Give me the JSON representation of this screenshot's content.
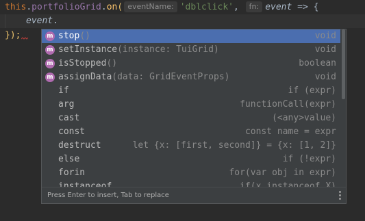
{
  "code": {
    "line1": {
      "this_kw": "this",
      "dot1": ".",
      "prop": "portfolioGrid",
      "dot2": ".",
      "method": "on",
      "open_paren": "(",
      "hint_event_name": "eventName:",
      "string_arg": "'dblclick'",
      "comma": ",",
      "hint_fn": "fn:",
      "param": "event",
      "arrow": "=>",
      "brace": "{"
    },
    "line2": {
      "typed": "event",
      "dot": "."
    },
    "line3": {
      "close": "});"
    }
  },
  "completion": {
    "items": [
      {
        "badge": "m",
        "name": "stop",
        "sig": "()",
        "type": "void",
        "selected": true
      },
      {
        "badge": "m",
        "name": "setInstance",
        "sig": "(instance: TuiGrid)",
        "type": "void"
      },
      {
        "badge": "m",
        "name": "isStopped",
        "sig": "()",
        "type": "boolean"
      },
      {
        "badge": "m",
        "name": "assignData",
        "sig": "(data: GridEventProps)",
        "type": "void"
      },
      {
        "name": "if",
        "type": "if (expr)"
      },
      {
        "name": "arg",
        "type": "functionCall(expr)"
      },
      {
        "name": "cast",
        "type": "(<any>value)"
      },
      {
        "name": "const",
        "type": "const name = expr"
      },
      {
        "name": "destruct",
        "type": "let {x: [first, second]} = {x: [1, 2]}"
      },
      {
        "name": "else",
        "type": "if (!expr)"
      },
      {
        "name": "forin",
        "type": "for(var obj in expr)"
      },
      {
        "name": "instanceof",
        "type": "if(x instanceof X)"
      }
    ],
    "footer_hint": "Press Enter to insert, Tab to replace",
    "menu_icon": "vertical-dots-icon"
  },
  "colors": {
    "selection": "#4b6eaf",
    "method_badge": "#b06bb0"
  }
}
